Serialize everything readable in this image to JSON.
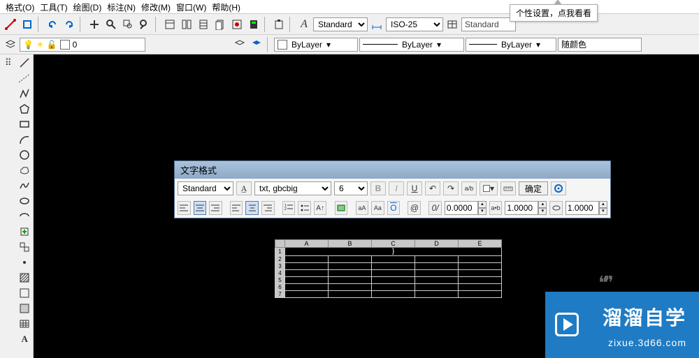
{
  "menu": {
    "format": "格式(O)",
    "tools": "工具(T)",
    "draw": "绘图(D)",
    "annotate": "标注(N)",
    "modify": "修改(M)",
    "window": "窗口(W)",
    "help": "帮助(H)"
  },
  "tooltip": "个性设置，点我看看",
  "toolbar1": {
    "text_style": "Standard",
    "dim_style": "ISO-25",
    "table_style": "Standard"
  },
  "layerbar": {
    "layer_name": "0",
    "linetype": "ByLayer",
    "lineweight": "ByLayer",
    "plotstyle": "ByLayer",
    "color": "随颜色"
  },
  "textpanel": {
    "title": "文字格式",
    "style": "Standard",
    "font": "txt, gbcbig",
    "height": "6",
    "ok": "确定",
    "tracking": "0.0000",
    "factor_ab": "1.0000",
    "factor_o": "1.0000",
    "bold": "B",
    "italic": "I",
    "underline": "U",
    "at": "@"
  },
  "table": {
    "cols": [
      "",
      "A",
      "B",
      "C",
      "D",
      "E"
    ],
    "rows": [
      "1",
      "2",
      "3",
      "4",
      "5",
      "6",
      "7"
    ],
    "active_cell": "}"
  },
  "watermark": {
    "brand": "溜溜自学",
    "url": "zixue.3d66.com"
  }
}
